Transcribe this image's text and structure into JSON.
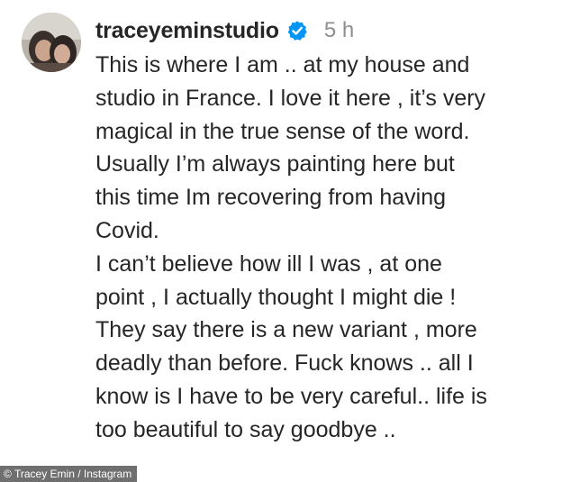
{
  "post": {
    "username": "traceyeminstudio",
    "verified_icon": "verified-badge-icon",
    "timestamp": "5 h",
    "caption_lines": [
      "This is where I am .. at my house and",
      "studio in France. I love it here , it’s very",
      "magical in the true sense of the word.",
      "Usually I’m always painting here but",
      "this time Im recovering from having",
      "Covid.",
      "I can’t believe how ill I was , at one",
      "point , I actually thought I might die !",
      "They say there is a new variant , more",
      "deadly than before. Fuck knows .. all I",
      "know is I have to be very careful.. life is",
      "too beautiful to say goodbye .."
    ]
  },
  "credit": "© Tracey Emin / Instagram",
  "colors": {
    "text": "#262626",
    "timestamp": "#8e8e8e",
    "verified": "#0095f6",
    "credit_bg": "#6f6f6f"
  }
}
